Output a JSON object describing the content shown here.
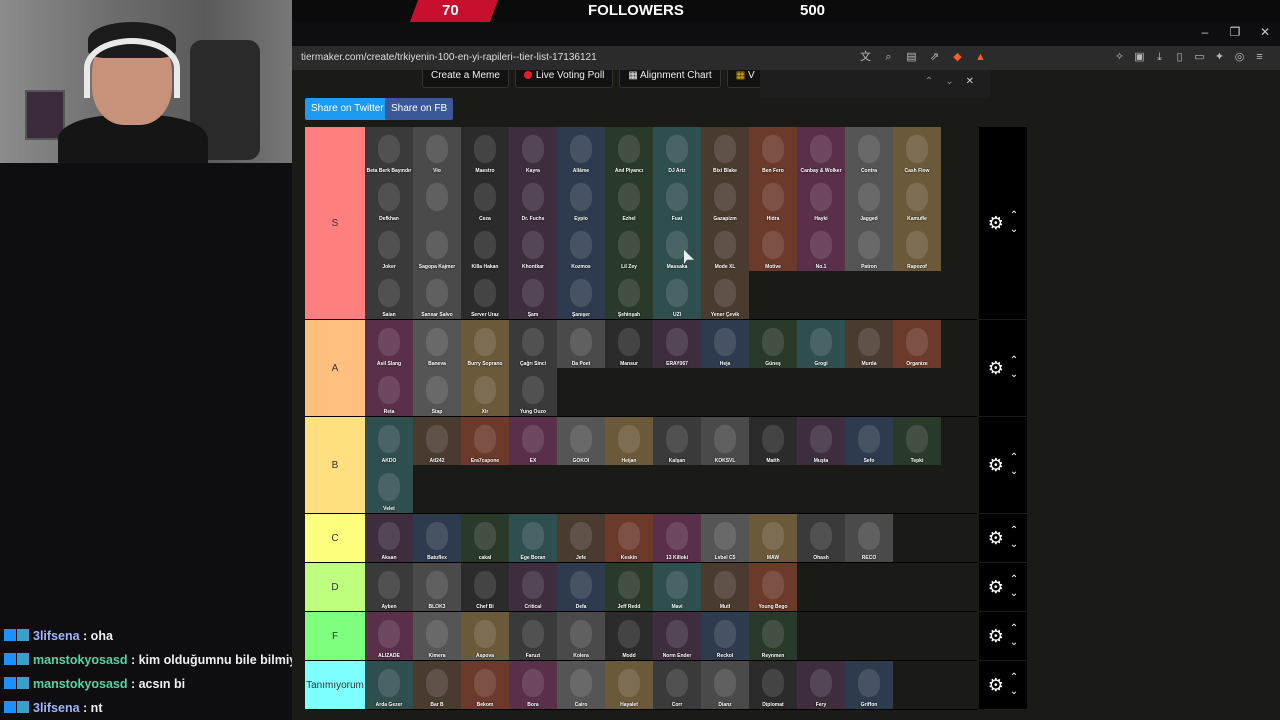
{
  "banner": {
    "left_num": "70",
    "label": "FOLLOWERS",
    "right_num": "500"
  },
  "window": {
    "minimize": "–",
    "maximize": "❐",
    "close": "✕"
  },
  "browser": {
    "url": "tiermaker.com/create/trkiyenin-100-en-yi-rapileri--tier-list-17136121",
    "icons": [
      "translate-icon",
      "zoom-icon",
      "reader-icon",
      "share-icon",
      "brave-shield-icon",
      "brave-rewards-icon"
    ],
    "right_icons": [
      "extensions-icon",
      "sidebar-icon",
      "download-icon",
      "panel-icon",
      "wallet-icon",
      "leo-icon",
      "vpn-icon",
      "menu-icon"
    ]
  },
  "page": {
    "top_buttons": [
      "Create a Meme",
      "Live Voting Poll",
      "Alignment Chart",
      "V"
    ],
    "find_close": "✕",
    "share_twitter": "Share on Twitter",
    "share_fb": "Share on FB"
  },
  "tiers": [
    {
      "label": "S",
      "color": "#ff7f7f",
      "items": [
        "Beta Berk Bayındır",
        "Vio",
        "Maestro",
        "Kayra",
        "Allâme",
        "Anıl Piyancı",
        "DJ Artz",
        "Bixi Blake",
        "Ben Fero",
        "Canbay & Wolker",
        "Contra",
        "Cash Flow",
        "Defkhan",
        "",
        "Ceza",
        "Dr. Fuchs",
        "Eypio",
        "Ezhel",
        "Fuat",
        "Gazapizm",
        "Hidra",
        "Hayki",
        "Jagged",
        "Kamufle",
        "Joker",
        "Sagopa Kajmer",
        "Killa Hakan",
        "Khontkar",
        "Kozmos",
        "Lil Zey",
        "Massaka",
        "Mode XL",
        "Motive",
        "No.1",
        "Patron",
        "Rapozof",
        "Saian",
        "Sansar Salvo",
        "Server Uraz",
        "Şam",
        "Şanışer",
        "Şehinşah",
        "UZI",
        "Yener Çevik"
      ]
    },
    {
      "label": "A",
      "color": "#ffbf7f",
      "items": [
        "Asil Slang",
        "Baneva",
        "Burry Soprano",
        "Çağrı Sinci",
        "Da Poet",
        "Mansur",
        "ERAY067",
        "Heja",
        "Güneş",
        "Grogi",
        "Murda",
        "Organize",
        "Reta",
        "Stap",
        "Xir",
        "Yung Ouzo"
      ]
    },
    {
      "label": "B",
      "color": "#ffdf7f",
      "items": [
        "AKDO",
        "Atl242",
        "Era7capone",
        "EX",
        "GOKOI",
        "Heijan",
        "Kalşan",
        "KÖKSVL",
        "Matth",
        "Muşta",
        "Sefo",
        "Tepki",
        "Velet"
      ]
    },
    {
      "label": "C",
      "color": "#ffff7f",
      "items": [
        "Aksan",
        "Batuflex",
        "cakal",
        "Ege Boran",
        "Jefe",
        "Keskin",
        "13 Killoki",
        "Lvbel C5",
        "MAW",
        "Ohash",
        "RECO"
      ]
    },
    {
      "label": "D",
      "color": "#bfff7f",
      "items": [
        "Ayben",
        "BLOK3",
        "Chef Bi",
        "Critical",
        "Defa",
        "Jeff Redd",
        "Mavi",
        "Mutl",
        "Young Bego"
      ]
    },
    {
      "label": "F",
      "color": "#7fff7f",
      "items": [
        "ALIZADE",
        "Kimera",
        "Aspova",
        "Faruzi",
        "Kolera",
        "Modd",
        "Norm Ender",
        "Reckol",
        "Reynmen"
      ]
    },
    {
      "label": "Tanımıyorum",
      "color": "#7fffff",
      "items": [
        "Arda Gezer",
        "Bar B",
        "Bekom",
        "Bora",
        "Cairo",
        "Hayalet",
        "Corr",
        "Dianz",
        "Diplomat",
        "Fery",
        "Griffon"
      ]
    }
  ],
  "tile_colors": [
    "#3a3a3a",
    "#4a3b2f",
    "#2b2b2b",
    "#5a2f4a",
    "#2e3b4e",
    "#6b5a3a",
    "#2f4f4f",
    "#4a4a4a",
    "#6b3a2a",
    "#3d2d3d",
    "#555555",
    "#2a3a2a"
  ],
  "chat": [
    {
      "user": "3lifsena",
      "msg": ": oha",
      "color": "a"
    },
    {
      "user": "manstokyosasd",
      "msg": ": kim olduğumnu bile bilmiyorum",
      "color": "b"
    },
    {
      "user": "manstokyosasd",
      "msg": ": acsın bi",
      "color": "b"
    },
    {
      "user": "3lifsena",
      "msg": ": nt",
      "color": "a"
    }
  ]
}
